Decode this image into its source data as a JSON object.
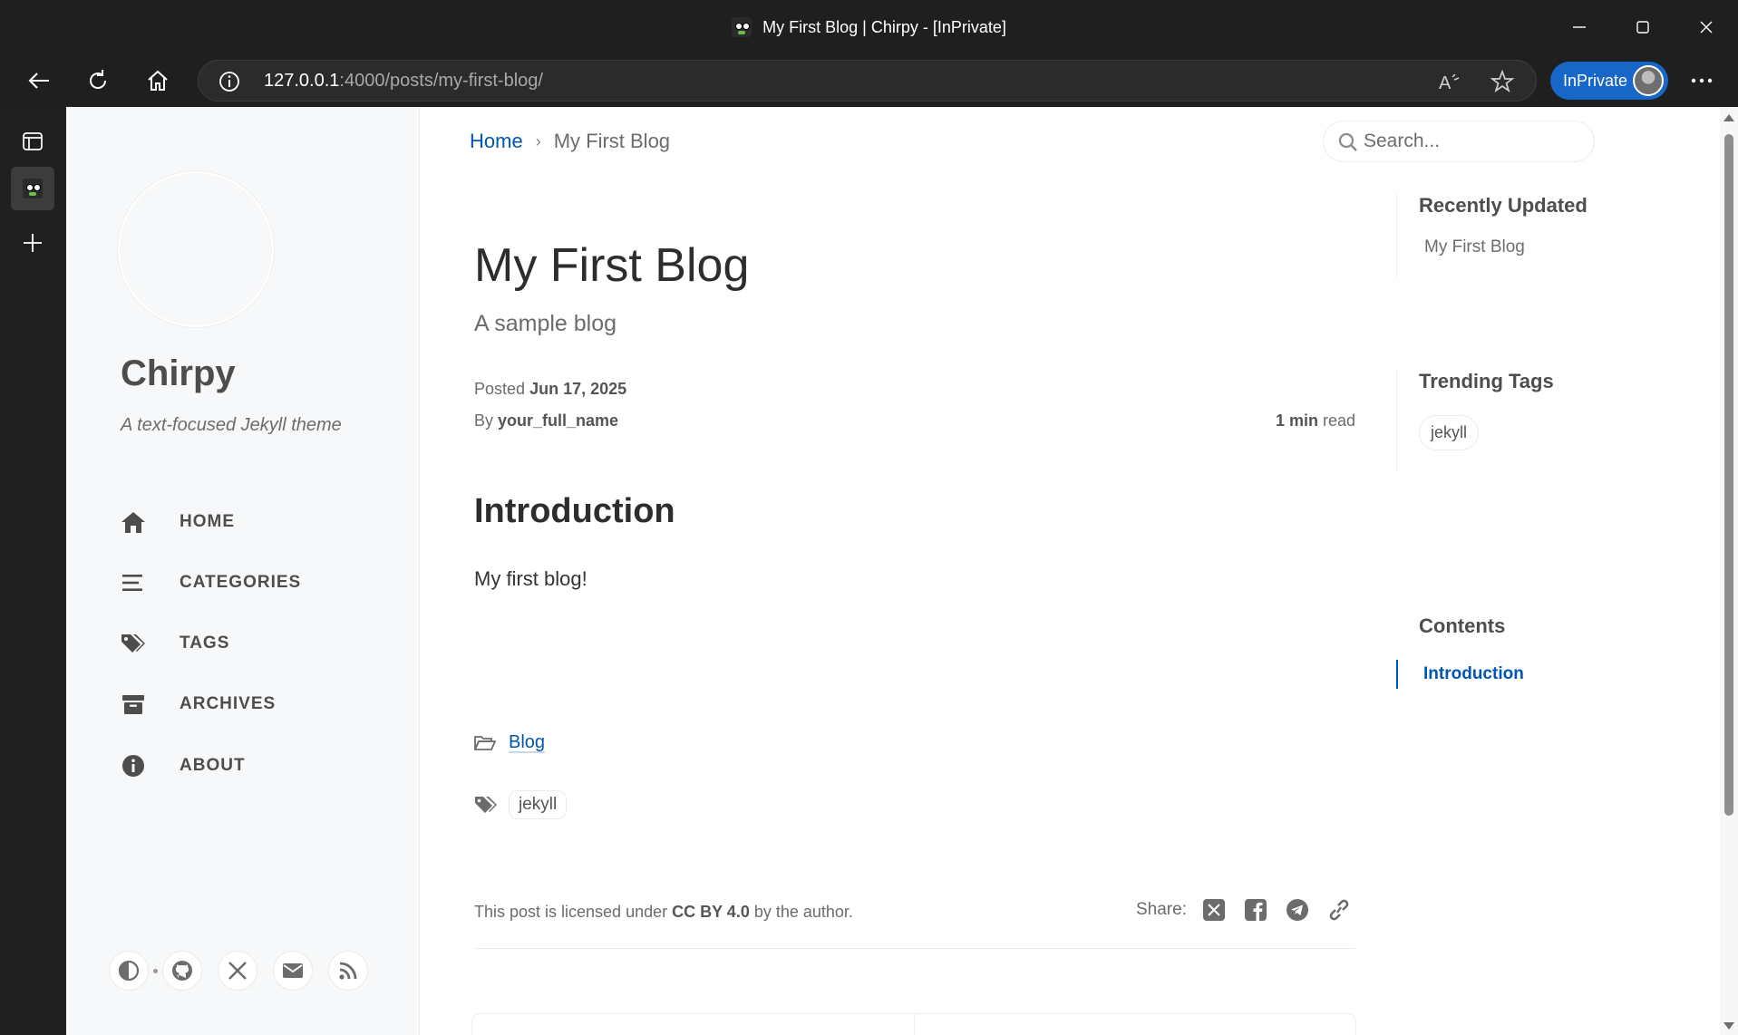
{
  "browser": {
    "window_title": "My First Blog | Chirpy - [InPrivate]",
    "url_host": "127.0.0.1",
    "url_path": ":4000/posts/my-first-blog/",
    "inprivate_label": "InPrivate"
  },
  "sidebar": {
    "site_title": "Chirpy",
    "site_subtitle": "A text-focused Jekyll theme",
    "menu": [
      {
        "label": "HOME",
        "icon": "home-icon"
      },
      {
        "label": "CATEGORIES",
        "icon": "stream-icon"
      },
      {
        "label": "TAGS",
        "icon": "tags-icon"
      },
      {
        "label": "ARCHIVES",
        "icon": "archive-icon"
      },
      {
        "label": "ABOUT",
        "icon": "info-circle-icon"
      }
    ],
    "bottom_icons": [
      "theme-toggle-icon",
      "github-icon",
      "x-twitter-icon",
      "email-icon",
      "rss-icon"
    ]
  },
  "topbar": {
    "breadcrumb_home": "Home",
    "breadcrumb_separator": "›",
    "breadcrumb_current": "My First Blog",
    "search_placeholder": "Search..."
  },
  "post": {
    "title": "My First Blog",
    "subtitle": "A sample blog",
    "posted_label": "Posted",
    "posted_date": "Jun 17, 2025",
    "by_label": "By",
    "author": "your_full_name",
    "read_time": "1 min",
    "read_label": "read",
    "heading": "Introduction",
    "body": "My first blog!",
    "category": "Blog",
    "tag": "jekyll",
    "license_prefix": "This post is licensed under",
    "license_name": "CC BY 4.0",
    "license_suffix": "by the author.",
    "share_label": "Share:"
  },
  "panel": {
    "recently_updated_title": "Recently Updated",
    "recently_updated_item": "My First Blog",
    "trending_tags_title": "Trending Tags",
    "trending_tag": "jekyll",
    "contents_title": "Contents",
    "contents_item": "Introduction"
  },
  "colors": {
    "link": "#0056b2",
    "sidebar_bg": "#f6f8fa",
    "browser_chrome": "#1f1f1f",
    "inprivate": "#1766c8"
  }
}
